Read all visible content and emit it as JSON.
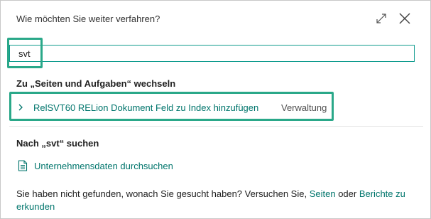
{
  "dialog": {
    "title": "Wie möchten Sie weiter verfahren?"
  },
  "search": {
    "value": "svt",
    "placeholder": ""
  },
  "pages_section": {
    "heading": "Zu „Seiten und Aufgaben“ wechseln",
    "results": [
      {
        "name": "RelSVT60 RELion Dokument Feld zu Index hinzufügen",
        "category": "Verwaltung"
      }
    ]
  },
  "search_section": {
    "heading": "Nach „svt“ suchen",
    "company_data_label": "Unternehmensdaten durchsuchen"
  },
  "footer": {
    "text_before": "Sie haben nicht gefunden, wonach Sie gesucht haben? Versuchen Sie, ",
    "link_pages": "Seiten",
    "text_middle": " oder ",
    "link_reports": "Berichte zu erkunden"
  },
  "colors": {
    "accent": "#00756c",
    "highlight": "#2aa889",
    "input_border": "#0f9b8e"
  },
  "icons": [
    "expand-icon",
    "close-icon",
    "chevron-right-icon",
    "document-icon"
  ]
}
